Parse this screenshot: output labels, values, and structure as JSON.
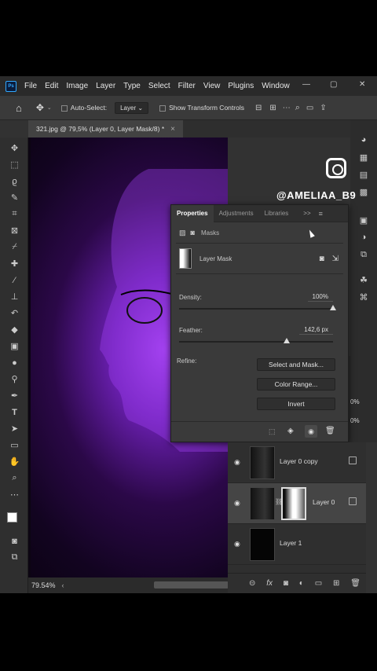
{
  "menubar": {
    "items": [
      "File",
      "Edit",
      "Image",
      "Layer",
      "Type",
      "Select",
      "Filter",
      "View",
      "Plugins",
      "Window"
    ],
    "window_controls": [
      "—",
      "▢",
      "✕"
    ]
  },
  "options": {
    "auto_select_label": "Auto-Select:",
    "auto_select_value": "Layer",
    "show_transform_label": "Show Transform Controls"
  },
  "document": {
    "tab_title": "321.jpg @ 79,5% (Layer 0, Layer Mask/8) *",
    "close": "×",
    "zoom": "79.54%"
  },
  "watermark": {
    "handle": "@AMELIAA_B9"
  },
  "properties": {
    "tabs": [
      "Properties",
      "Adjustments",
      "Libraries"
    ],
    "masks_label": "Masks",
    "layer_mask_label": "Layer Mask",
    "density_label": "Density:",
    "density_value": "100%",
    "density": 1.0,
    "feather_label": "Feather:",
    "feather_value": "142,6 px",
    "feather": 0.7,
    "refine_label": "Refine:",
    "buttons": [
      "Select and Mask...",
      "Color Range...",
      "Invert"
    ]
  },
  "layers": {
    "rows": [
      {
        "name": "Layer 0 copy"
      },
      {
        "name": "Layer 0"
      },
      {
        "name": "Layer 1"
      }
    ],
    "opacity_values": [
      "0%",
      "0%"
    ]
  },
  "colors": {
    "accent": "#31a8ff",
    "panel": "#3a3a3a",
    "canvas_glow": "#a040e8"
  }
}
